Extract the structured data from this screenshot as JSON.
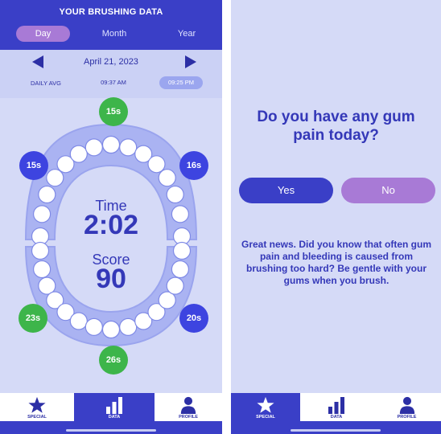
{
  "header": {
    "title": "YOUR BRUSHING DATA"
  },
  "period_tabs": [
    {
      "label": "Day",
      "active": true
    },
    {
      "label": "Month",
      "active": false
    },
    {
      "label": "Year",
      "active": false
    }
  ],
  "date_nav": {
    "date": "April 21, 2023",
    "daily_avg_label": "DAILY AVG",
    "sessions": [
      {
        "label": "09:37 AM",
        "selected": false
      },
      {
        "label": "09:25 PM",
        "selected": true
      }
    ]
  },
  "summary": {
    "time_label": "Time",
    "time_value": "2:02",
    "score_label": "Score",
    "score_value": "90"
  },
  "zones": {
    "top": "15s",
    "upper_left": "15s",
    "upper_right": "16s",
    "lower_left": "23s",
    "lower_right": "20s",
    "bottom": "26s"
  },
  "question_screen": {
    "question": "Do you have any gum pain today?",
    "yes_label": "Yes",
    "no_label": "No",
    "info": "Great news. Did you know that often gum pain and bleeding is caused from brushing too hard? Be gentle with your gums when you brush."
  },
  "nav": {
    "special": "SPECIAL",
    "data": "DATA",
    "profile": "PROFILE"
  },
  "colors": {
    "primary": "#3a3fc7",
    "accent_purple": "#a87ad6",
    "background": "#d5daf7",
    "zone_good": "#3db54a",
    "zone_low": "#3d44e0"
  }
}
